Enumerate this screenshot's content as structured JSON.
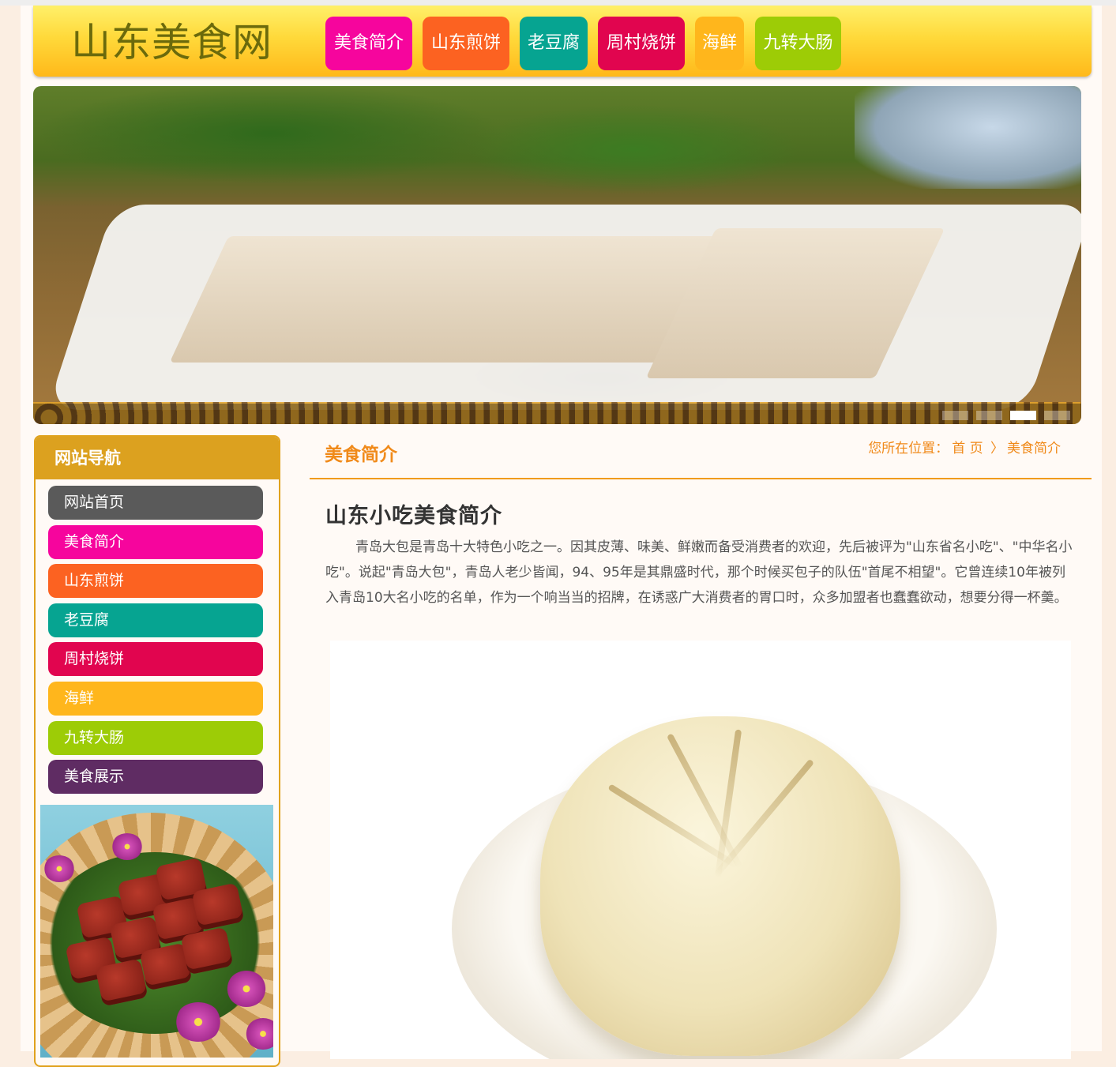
{
  "header": {
    "logo": "山东美食网",
    "nav": [
      {
        "label": "美食简介",
        "color": "#f6059d"
      },
      {
        "label": "山东煎饼",
        "color": "#fc6221"
      },
      {
        "label": "老豆腐",
        "color": "#06a491"
      },
      {
        "label": "周村烧饼",
        "color": "#e1054f"
      },
      {
        "label": "海鲜",
        "color": "#ffb61c"
      },
      {
        "label": "九转大肠",
        "color": "#9dcc06"
      }
    ]
  },
  "banner": {
    "slides": 4,
    "active_slide": 3
  },
  "sidebar": {
    "title": "网站导航",
    "items": [
      {
        "label": "网站首页",
        "color": "#5a5a5a"
      },
      {
        "label": "美食简介",
        "color": "#f6059d"
      },
      {
        "label": "山东煎饼",
        "color": "#fc6221"
      },
      {
        "label": "老豆腐",
        "color": "#06a491"
      },
      {
        "label": "周村烧饼",
        "color": "#e1054f"
      },
      {
        "label": "海鲜",
        "color": "#ffb61c"
      },
      {
        "label": "九转大肠",
        "color": "#9dcc06"
      },
      {
        "label": "美食展示",
        "color": "#5f2c63"
      }
    ]
  },
  "content": {
    "section_title": "美食简介",
    "breadcrumb": {
      "prefix": "您所在位置：",
      "home": "首 页",
      "separator": "〉",
      "current": "美食简介"
    },
    "article_title": "山东小吃美食简介",
    "article_body": "青岛大包是青岛十大特色小吃之一。因其皮薄、味美、鲜嫩而备受消费者的欢迎，先后被评为\"山东省名小吃\"、\"中华名小吃\"。说起\"青岛大包\"，青岛人老少皆闻，94、95年是其鼎盛时代，那个时候买包子的队伍\"首尾不相望\"。它曾连续10年被列入青岛10大名小吃的名单，作为一个响当当的招牌，在诱惑广大消费者的胃口时，众多加盟者也蠢蠢欲动，想要分得一杯羹。"
  },
  "colors": {
    "accent": "#f08a1a",
    "sidebar_border": "#e0a21d",
    "page_bg": "#fbeee2"
  }
}
